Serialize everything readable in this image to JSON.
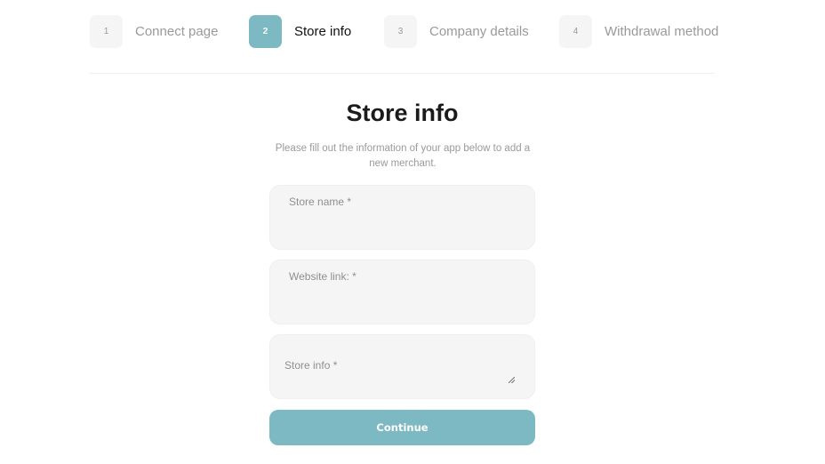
{
  "stepper": {
    "steps": [
      {
        "number": "1",
        "label": "Connect page",
        "state": "inactive"
      },
      {
        "number": "2",
        "label": "Store info",
        "state": "active"
      },
      {
        "number": "3",
        "label": "Company details",
        "state": "inactive"
      },
      {
        "number": "4",
        "label": "Withdrawal method",
        "state": "inactive"
      }
    ]
  },
  "form": {
    "title": "Store info",
    "subtitle": "Please fill out the information of your app below to add a new merchant.",
    "fields": [
      {
        "name": "store-name",
        "placeholder": "Store name *",
        "value": ""
      },
      {
        "name": "website-link",
        "placeholder": "Website link: *",
        "value": ""
      },
      {
        "name": "store-info",
        "placeholder": "Store info *",
        "value": ""
      }
    ],
    "continue_label": "Continue"
  },
  "colors": {
    "accent": "#7db9c3",
    "field_bg": "#f5f5f5",
    "muted_text": "#9a9a9a",
    "title_text": "#1b1b1b"
  }
}
